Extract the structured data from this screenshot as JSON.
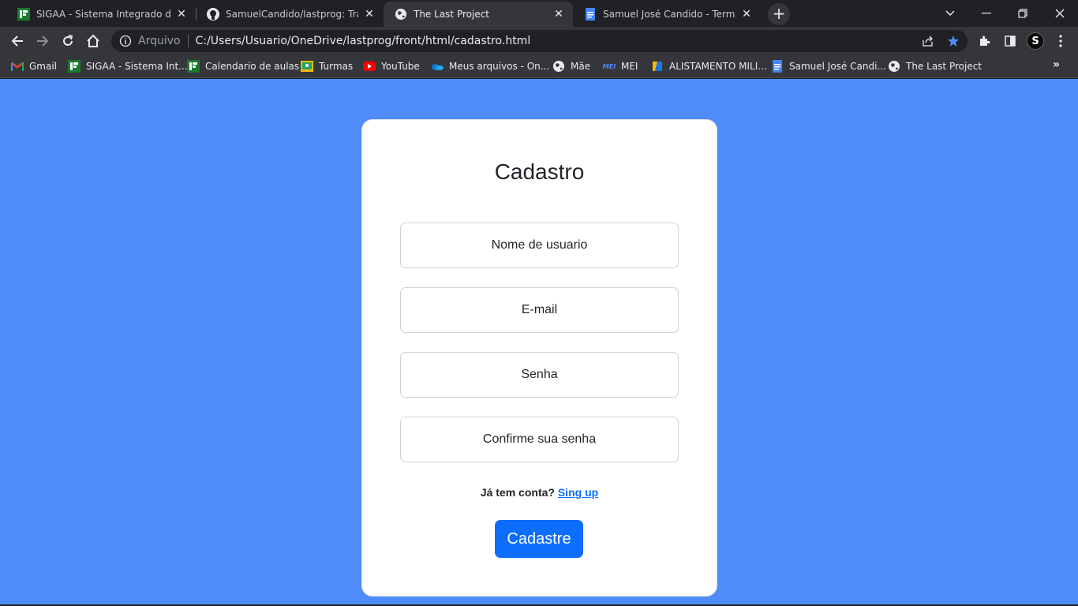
{
  "tabs": [
    {
      "title": "SIGAA - Sistema Integrado de Ge",
      "icon": "sigaa-icon"
    },
    {
      "title": "SamuelCandido/lastprog: Traball",
      "icon": "github-icon"
    },
    {
      "title": "The Last Project",
      "icon": "globe-icon",
      "active": true
    },
    {
      "title": "Samuel José Candido - Termos G",
      "icon": "docs-icon"
    }
  ],
  "address_bar": {
    "scheme_label": "Arquivo",
    "url": "C:/Users/Usuario/OneDrive/lastprog/front/html/cadastro.html"
  },
  "profile": {
    "initial": "S"
  },
  "bookmarks": [
    {
      "label": "Gmail",
      "icon": "gmail-icon"
    },
    {
      "label": "SIGAA - Sistema Int...",
      "icon": "sigaa-icon"
    },
    {
      "label": "Calendario de aulas",
      "icon": "sigaa-icon"
    },
    {
      "label": "Turmas",
      "icon": "classroom-icon"
    },
    {
      "label": "YouTube",
      "icon": "youtube-icon"
    },
    {
      "label": "Meus arquivos - On...",
      "icon": "onedrive-icon"
    },
    {
      "label": "Mãe",
      "icon": "globe-icon"
    },
    {
      "label": "MEI",
      "icon": "mei-icon"
    },
    {
      "label": "ALISTAMENTO MILI...",
      "icon": "alistamento-icon"
    },
    {
      "label": "Samuel José Candi...",
      "icon": "docs-icon"
    },
    {
      "label": "The Last Project",
      "icon": "globe-icon"
    }
  ],
  "form": {
    "title": "Cadastro",
    "username_placeholder": "Nome de usuario",
    "email_placeholder": "E-mail",
    "password_placeholder": "Senha",
    "confirm_placeholder": "Confirme sua senha",
    "hint_text": "Já tem conta?",
    "hint_link": "Sing up",
    "submit_label": "Cadastre"
  },
  "colors": {
    "page_background": "#4f8cf9",
    "primary_button": "#0d6efd",
    "link": "#0d6efd"
  }
}
